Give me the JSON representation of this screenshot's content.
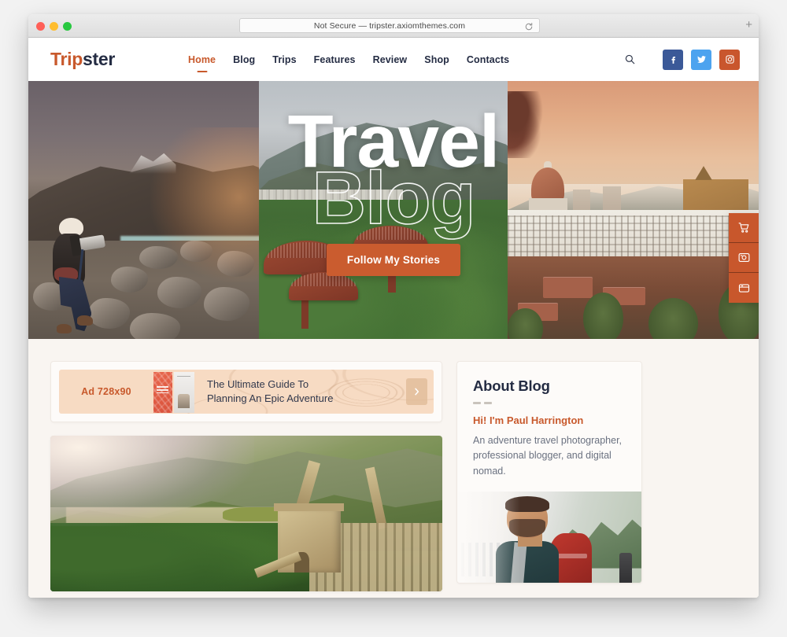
{
  "browser": {
    "url_text": "Not Secure — tripster.axiomthemes.com",
    "reload_icon": "reload-icon",
    "new_tab_icon": "plus-icon",
    "traffic_lights": [
      "close",
      "minimize",
      "zoom"
    ]
  },
  "site": {
    "logo": {
      "part1": "Trip",
      "part2": "ster"
    },
    "nav": [
      {
        "label": "Home",
        "active": true
      },
      {
        "label": "Blog",
        "active": false
      },
      {
        "label": "Trips",
        "active": false
      },
      {
        "label": "Features",
        "active": false
      },
      {
        "label": "Review",
        "active": false
      },
      {
        "label": "Shop",
        "active": false
      },
      {
        "label": "Contacts",
        "active": false
      }
    ],
    "search_icon": "search-icon",
    "social": [
      {
        "name": "facebook",
        "color": "#3b5998"
      },
      {
        "name": "twitter",
        "color": "#4da3ef"
      },
      {
        "name": "instagram",
        "color": "#c9562d"
      }
    ]
  },
  "hero": {
    "title_line1": "Travel",
    "title_line2": "Blog",
    "cta_label": "Follow My Stories",
    "panels": [
      {
        "alt": "photographer on rocky glacier valley"
      },
      {
        "alt": "asian temple roofs with mountain and jungle"
      },
      {
        "alt": "florence cityscape with duomo at sunset"
      }
    ]
  },
  "side_rail": [
    {
      "icon": "cart-icon"
    },
    {
      "icon": "gallery-icon"
    },
    {
      "icon": "window-icon"
    }
  ],
  "ad": {
    "label": "Ad 728x90",
    "headline_line1": "The Ultimate Guide To",
    "headline_line2": "Planning An Epic Adventure",
    "arrow_icon": "chevron-right-icon",
    "book_alt": "planning an epic adventure book"
  },
  "post": {
    "image_alt": "great wall of china aerial view"
  },
  "about": {
    "title": "About Blog",
    "lead": "Hi! I'm Paul Harrington",
    "text": "An adventure travel photographer, professional blogger, and digital nomad.",
    "photo_alt": "paul harrington with red backpack"
  },
  "colors": {
    "accent": "#c8592c",
    "dark": "#242c43",
    "page_bg": "#f9f5f1",
    "ad_bg": "#f7dbc3"
  }
}
